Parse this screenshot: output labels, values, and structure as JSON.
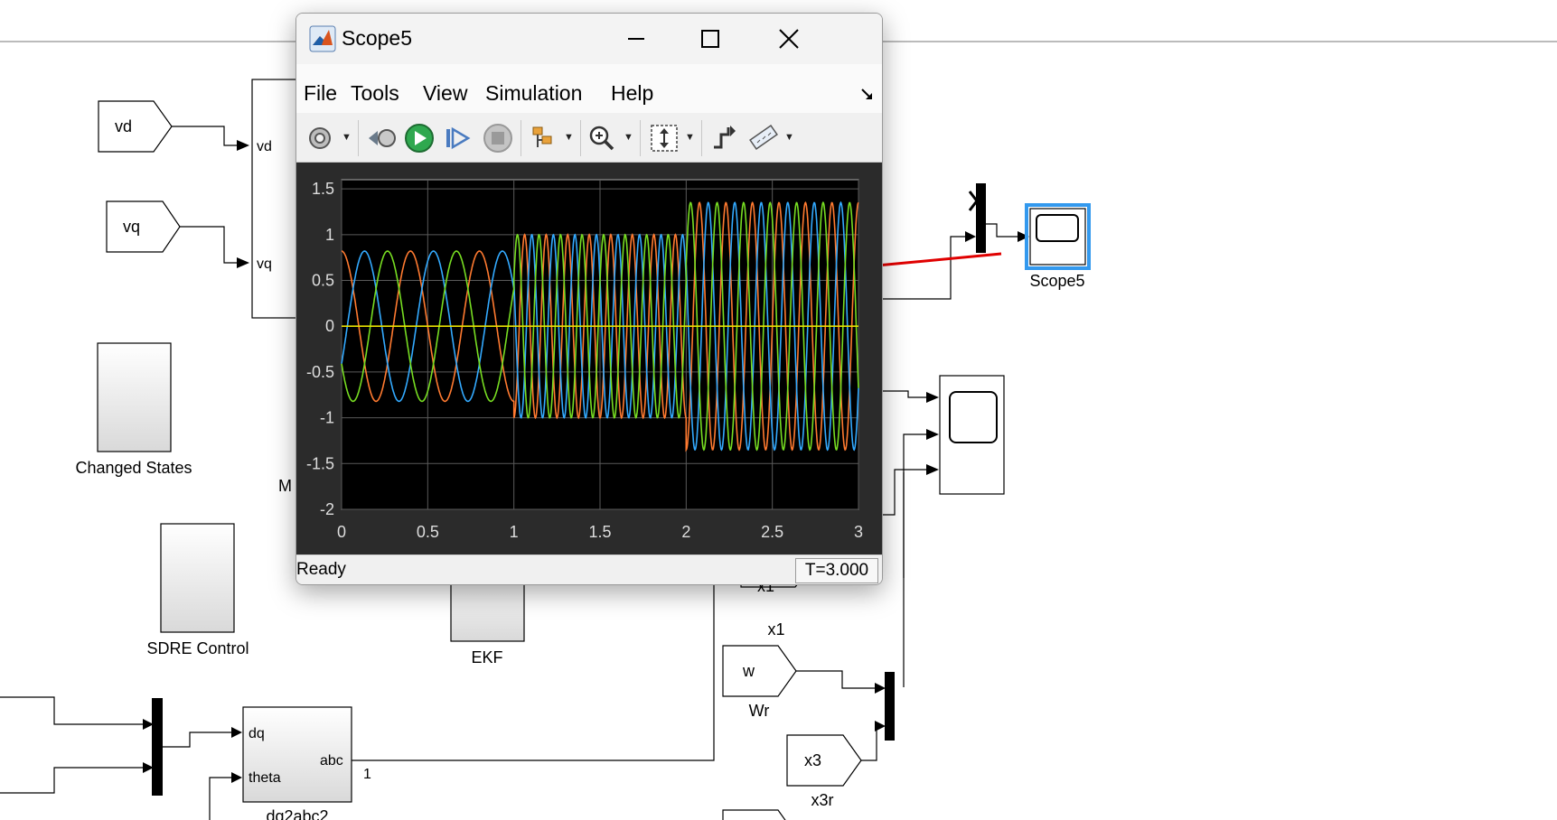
{
  "diagram": {
    "blocks": {
      "vd_goto": "vd",
      "vq_goto": "vq",
      "mux_port_vd": "vd",
      "mux_port_vq": "vq",
      "changed_states": "Changed States",
      "sdre_control": "SDRE Control",
      "ekf": "EKF",
      "m_label": "M",
      "dq2abc_port_dq": "dq",
      "dq2abc_port_theta": "theta",
      "dq2abc_port_abc": "abc",
      "dq2abc_name": "dq2abc2",
      "signal_index": "1",
      "x1_goto": "x1",
      "x1_name": "x1",
      "w_goto": "w",
      "w_name": "Wr",
      "x3_goto": "x3",
      "x3_name": "x3r",
      "scope5_name": "Scope5"
    }
  },
  "scope_window": {
    "title": "Scope5",
    "menu": [
      "File",
      "Tools",
      "View",
      "Simulation",
      "Help"
    ],
    "toolbar_icons": [
      "settings-icon",
      "restore-icon",
      "run-icon",
      "step-forward-icon",
      "stop-icon",
      "highlight-icon",
      "zoom-in-icon",
      "autoscale-icon",
      "trigger-icon",
      "measure-icon"
    ],
    "status": "Ready",
    "time": "T=3.000"
  },
  "chart_data": {
    "type": "line",
    "xlim": [
      0,
      3
    ],
    "ylim": [
      -2,
      1.6
    ],
    "xticks": [
      "0",
      "0.5",
      "1",
      "1.5",
      "2",
      "2.5",
      "3"
    ],
    "yticks": [
      "1.5",
      "1",
      "0.5",
      "0",
      "-0.5",
      "-1",
      "-1.5",
      "-2"
    ],
    "grid": true,
    "background": "#000000",
    "series": [
      {
        "color": "#ff7a30",
        "phase_deg": 90,
        "segments": [
          {
            "t0": 0,
            "t1": 1,
            "freq_hz": 2.5,
            "amp": 0.82
          },
          {
            "t0": 1,
            "t1": 2,
            "freq_hz": 8.0,
            "amp": 1.0
          },
          {
            "t0": 2,
            "t1": 3,
            "freq_hz": 6.5,
            "amp": 1.35
          }
        ]
      },
      {
        "color": "#33aaff",
        "phase_deg": -30,
        "segments": [
          {
            "t0": 0,
            "t1": 1,
            "freq_hz": 2.5,
            "amp": 0.82
          },
          {
            "t0": 1,
            "t1": 2,
            "freq_hz": 8.0,
            "amp": 1.0
          },
          {
            "t0": 2,
            "t1": 3,
            "freq_hz": 6.5,
            "amp": 1.35
          }
        ]
      },
      {
        "color": "#77dd22",
        "phase_deg": 210,
        "segments": [
          {
            "t0": 0,
            "t1": 1,
            "freq_hz": 2.5,
            "amp": 0.82
          },
          {
            "t0": 1,
            "t1": 2,
            "freq_hz": 8.0,
            "amp": 1.0
          },
          {
            "t0": 2,
            "t1": 3,
            "freq_hz": 6.5,
            "amp": 1.35
          }
        ]
      },
      {
        "color": "#e8e000",
        "phase_deg": 0,
        "segments": [
          {
            "t0": 0,
            "t1": 3,
            "freq_hz": 0,
            "amp": 0
          }
        ]
      }
    ]
  },
  "colors": {
    "annotation_arrow": "#e00000",
    "scope_selected_border": "#3399ee"
  }
}
